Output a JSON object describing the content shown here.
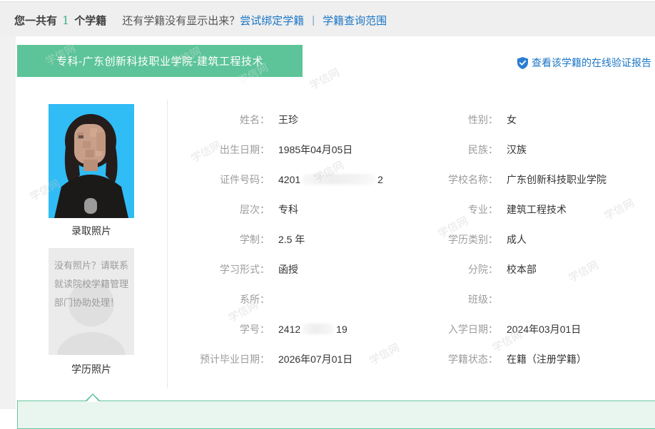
{
  "topbar": {
    "prefix": "您一共有",
    "count": "1",
    "suffix": "个学籍",
    "question": "还有学籍没有显示出来？",
    "bind_link": "尝试绑定学籍",
    "separator": "|",
    "scope_link": "学籍查询范围"
  },
  "tab": {
    "title": "专科-广东创新科技职业学院-建筑工程技术"
  },
  "verify_link": "查看该学籍的在线验证报告",
  "photos": {
    "admission_caption": "录取照片",
    "degree_caption": "学历照片",
    "no_photo_text": "没有照片？请联系就读院校学籍管理部门协助处理！"
  },
  "fields": {
    "left": [
      {
        "label": "姓名：",
        "value": "王珍"
      },
      {
        "label": "出生日期：",
        "value": "1985年04月05日"
      },
      {
        "label": "证件号码：",
        "value_prefix": "4201",
        "value_suffix": "2",
        "redacted": true
      },
      {
        "label": "层次：",
        "value": "专科"
      },
      {
        "label": "学制：",
        "value": "2.5 年"
      },
      {
        "label": "学习形式：",
        "value": "函授"
      },
      {
        "label": "系所：",
        "value": ""
      },
      {
        "label": "学号：",
        "value_prefix": "2412",
        "value_suffix": "19",
        "redacted": true
      },
      {
        "label": "预计毕业日期：",
        "value": "2026年07月01日"
      }
    ],
    "right": [
      {
        "label": "性别：",
        "value": "女"
      },
      {
        "label": "民族：",
        "value": "汉族"
      },
      {
        "label": "学校名称：",
        "value": "广东创新科技职业学院"
      },
      {
        "label": "专业：",
        "value": "建筑工程技术"
      },
      {
        "label": "学历类别：",
        "value": "成人"
      },
      {
        "label": "分院：",
        "value": "校本部"
      },
      {
        "label": "班级：",
        "value": ""
      },
      {
        "label": "入学日期：",
        "value": "2024年03月01日"
      },
      {
        "label": "学籍状态：",
        "value": "在籍（注册学籍）"
      }
    ]
  },
  "watermark": "学信网",
  "colors": {
    "tab_green": "#5cc498",
    "link_blue": "#1b76c5",
    "count_green": "#3eb389",
    "callout_bg": "#e9f6ef",
    "callout_border": "#67c49e",
    "photo_background_blue": "#30bcf5"
  }
}
